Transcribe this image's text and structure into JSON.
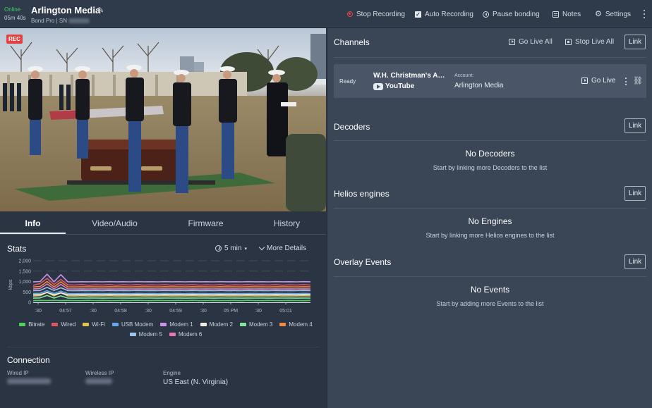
{
  "header": {
    "status": "Online",
    "uptime": "05m 40s",
    "unit_name": "Arlington Media",
    "unit_subtitle": "Bond Pro | SN",
    "actions": {
      "stop_recording": "Stop Recording",
      "auto_recording": "Auto Recording",
      "pause_bonding": "Pause bonding",
      "notes": "Notes",
      "settings": "Settings"
    }
  },
  "video": {
    "badge": "REC"
  },
  "tabs": [
    "Info",
    "Video/Audio",
    "Firmware",
    "History"
  ],
  "stats": {
    "title": "Stats",
    "range": "5 min",
    "more_details": "More Details"
  },
  "chart_data": {
    "type": "line",
    "title": "",
    "ylabel": "kbps",
    "xlabel": "",
    "ylim": [
      0,
      2000
    ],
    "y_ticks": [
      "0",
      "500",
      "1,000",
      "1,500",
      "2,000"
    ],
    "x_ticks": [
      ":30",
      "04:57",
      ":30",
      "04:58",
      ":30",
      "04:59",
      ":30",
      "05 PM",
      ":30",
      "05:01"
    ],
    "x": [
      0,
      1,
      2,
      3,
      4,
      5,
      6,
      7,
      8,
      9,
      10,
      11,
      12,
      13,
      14,
      15,
      16,
      17,
      18,
      19,
      20,
      21,
      22,
      23,
      24,
      25,
      26,
      27,
      28,
      29,
      30,
      31,
      32,
      33,
      34,
      35,
      36,
      37,
      38,
      39,
      40
    ],
    "xlim": [
      0,
      40
    ],
    "series": [
      {
        "name": "Bitrate",
        "color": "#4fd05b",
        "values": [
          80,
          90,
          85,
          95,
          80,
          90,
          85,
          80,
          95,
          85,
          90,
          80,
          85,
          90,
          80,
          95,
          85,
          80,
          90,
          85,
          80,
          90,
          85,
          95,
          80,
          85,
          90,
          80,
          85,
          90,
          80,
          95,
          85,
          80,
          90,
          85,
          80,
          90,
          85,
          80,
          90
        ]
      },
      {
        "name": "Wired",
        "color": "#e0575f",
        "values": [
          820,
          900,
          1150,
          860,
          1100,
          840,
          830,
          850,
          820,
          840,
          830,
          850,
          820,
          845,
          830,
          850,
          825,
          840,
          830,
          850,
          820,
          840,
          835,
          850,
          825,
          840,
          830,
          850,
          820,
          840,
          835,
          850,
          825,
          840,
          830,
          850,
          820,
          840,
          830,
          850,
          830
        ]
      },
      {
        "name": "Wi-Fi",
        "color": "#e2c34d",
        "values": [
          300,
          320,
          480,
          310,
          460,
          305,
          300,
          315,
          300,
          310,
          305,
          315,
          300,
          310,
          305,
          315,
          300,
          310,
          305,
          315,
          300,
          310,
          305,
          315,
          300,
          310,
          305,
          315,
          300,
          310,
          305,
          315,
          300,
          310,
          305,
          315,
          300,
          310,
          305,
          315,
          305
        ]
      },
      {
        "name": "USB Modem",
        "color": "#66a9e8",
        "values": [
          420,
          430,
          560,
          425,
          540,
          420,
          415,
          425,
          420,
          425,
          418,
          428,
          420,
          425,
          418,
          428,
          420,
          425,
          418,
          428,
          420,
          425,
          418,
          428,
          420,
          425,
          418,
          428,
          420,
          425,
          418,
          428,
          420,
          425,
          418,
          428,
          420,
          425,
          418,
          428,
          420
        ]
      },
      {
        "name": "Modem 1",
        "color": "#c994e8",
        "values": [
          980,
          1000,
          1350,
          990,
          1330,
          985,
          980,
          990,
          985,
          990,
          982,
          992,
          985,
          990,
          982,
          992,
          985,
          990,
          982,
          992,
          985,
          990,
          982,
          992,
          985,
          990,
          982,
          992,
          985,
          990,
          982,
          992,
          985,
          990,
          982,
          992,
          985,
          990,
          982,
          992,
          985
        ]
      },
      {
        "name": "Modem 2",
        "color": "#f0efe0",
        "values": [
          360,
          370,
          470,
          365,
          450,
          362,
          360,
          366,
          362,
          366,
          360,
          368,
          362,
          366,
          360,
          368,
          362,
          366,
          360,
          368,
          362,
          366,
          360,
          368,
          362,
          366,
          360,
          368,
          362,
          366,
          360,
          368,
          362,
          366,
          360,
          368,
          362,
          366,
          360,
          368,
          362
        ]
      },
      {
        "name": "Modem 3",
        "color": "#86e6a0",
        "values": [
          200,
          210,
          330,
          205,
          310,
          202,
          200,
          206,
          202,
          206,
          200,
          208,
          202,
          206,
          200,
          208,
          202,
          206,
          200,
          208,
          202,
          206,
          200,
          208,
          202,
          206,
          200,
          208,
          202,
          206,
          200,
          208,
          202,
          206,
          200,
          208,
          202,
          206,
          200,
          208,
          202
        ]
      },
      {
        "name": "Modem 4",
        "color": "#ef8a44",
        "values": [
          740,
          760,
          1000,
          745,
          980,
          742,
          740,
          746,
          742,
          746,
          740,
          748,
          742,
          746,
          740,
          748,
          742,
          746,
          740,
          748,
          742,
          746,
          740,
          748,
          742,
          746,
          740,
          748,
          742,
          746,
          740,
          748,
          742,
          746,
          740,
          748,
          742,
          746,
          740,
          748,
          742
        ]
      },
      {
        "name": "Modem 5",
        "color": "#9fc4ef",
        "values": [
          560,
          570,
          720,
          565,
          700,
          562,
          560,
          566,
          562,
          566,
          560,
          568,
          562,
          566,
          560,
          568,
          562,
          566,
          560,
          568,
          562,
          566,
          560,
          568,
          562,
          566,
          560,
          568,
          562,
          566,
          560,
          568,
          562,
          566,
          560,
          568,
          562,
          566,
          560,
          568,
          562
        ]
      },
      {
        "name": "Modem 6",
        "color": "#e577b8",
        "values": [
          640,
          660,
          880,
          645,
          860,
          642,
          640,
          646,
          642,
          646,
          640,
          648,
          642,
          646,
          640,
          648,
          642,
          646,
          640,
          648,
          642,
          646,
          640,
          648,
          642,
          646,
          640,
          648,
          642,
          646,
          640,
          648,
          642,
          646,
          640,
          648,
          642,
          646,
          640,
          648,
          642
        ]
      }
    ],
    "grid": true,
    "legend": "bottom"
  },
  "connection": {
    "title": "Connection",
    "wired_ip_label": "Wired IP",
    "wireless_ip_label": "Wireless IP",
    "engine_label": "Engine",
    "engine_value": "US East (N. Virginia)"
  },
  "channels": {
    "title": "Channels",
    "go_live_all": "Go Live All",
    "stop_live_all": "Stop Live All",
    "link": "Link",
    "items": [
      {
        "status": "Ready",
        "name": "W.H. Christman's Arlington Media",
        "platform": "YouTube",
        "account_label": "Account:",
        "account": "Arlington Media",
        "go_live": "Go Live"
      }
    ]
  },
  "decoders": {
    "title": "Decoders",
    "link": "Link",
    "empty_title": "No Decoders",
    "empty_sub": "Start by linking more Decoders to the list"
  },
  "helios": {
    "title": "Helios engines",
    "link": "Link",
    "empty_title": "No Engines",
    "empty_sub": "Start by linking more Helios engines to the list"
  },
  "overlays": {
    "title": "Overlay Events",
    "link": "Link",
    "empty_title": "No Events",
    "empty_sub": "Start by adding more Events to the list"
  }
}
